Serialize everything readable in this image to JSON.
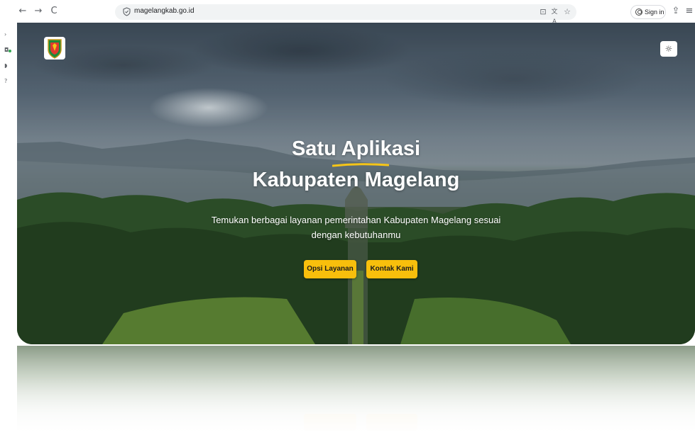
{
  "browser": {
    "url": "magelangkab.go.id",
    "sign_in_label": "Sign in",
    "back_icon": "←",
    "forward_icon": "→",
    "reload_icon": "C",
    "screen_icon": "⊡",
    "translate_icon": "文A",
    "star_icon": "☆",
    "extensions_icon": "⇪",
    "menu_icon": "≡"
  },
  "side_strip": {
    "marks": [
      "›",
      "◘",
      "◗",
      "?"
    ]
  },
  "hero": {
    "title_line1": "Satu Aplikasi",
    "title_line2": "Kabupaten Magelang",
    "subtitle": "Temukan berbagai layanan pemerintahan Kabupaten Magelang sesuai dengan kebutuhanmu",
    "primary_button": "Opsi Layanan",
    "secondary_button": "Kontak Kami",
    "theme_toggle_icon": "☼",
    "accent_color": "#f8bf0c",
    "underline_color": "#f5c518"
  }
}
